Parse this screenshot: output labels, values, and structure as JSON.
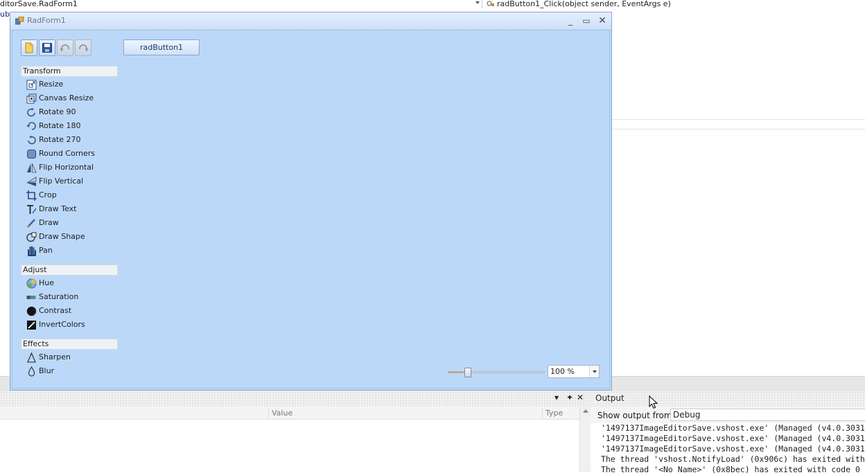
{
  "ide": {
    "nav_left": "ditorSave.RadForm1",
    "nav_right": "radButton1_Click(object sender, EventArgs e)",
    "code_snippet": "ub",
    "bottom_controls": {
      "dropdown": "▾",
      "pin": "✦",
      "close": "✕"
    },
    "output_title": "Output",
    "props": {
      "col_value": "Value",
      "col_type": "Type"
    },
    "output": {
      "show_from_label": "Show output from:",
      "source": "Debug",
      "lines": [
        "'1497137ImageEditorSave.vshost.exe' (Managed (v4.0.3031",
        "'1497137ImageEditorSave.vshost.exe' (Managed (v4.0.3031",
        "'1497137ImageEditorSave.vshost.exe' (Managed (v4.0.3031",
        "The thread 'vshost.NotifyLoad' (0x906c) has exited with",
        "The thread '<No Name>' (0x8bec) has exited with code 0"
      ]
    }
  },
  "form": {
    "title": "RadForm1",
    "minimize": "_",
    "maximize": "▭",
    "close": "✕",
    "button": "radButton1",
    "sections": [
      {
        "title": "Transform",
        "items": [
          {
            "label": "Resize",
            "icon": "resize-icon"
          },
          {
            "label": "Canvas Resize",
            "icon": "canvas-resize-icon"
          },
          {
            "label": "Rotate 90",
            "icon": "rotate-90-icon"
          },
          {
            "label": "Rotate 180",
            "icon": "rotate-180-icon"
          },
          {
            "label": "Rotate 270",
            "icon": "rotate-270-icon"
          },
          {
            "label": "Round Corners",
            "icon": "round-corners-icon"
          },
          {
            "label": "Flip Horizontal",
            "icon": "flip-horizontal-icon"
          },
          {
            "label": "Flip Vertical",
            "icon": "flip-vertical-icon"
          },
          {
            "label": "Crop",
            "icon": "crop-icon"
          },
          {
            "label": "Draw Text",
            "icon": "draw-text-icon"
          },
          {
            "label": "Draw",
            "icon": "draw-icon"
          },
          {
            "label": "Draw Shape",
            "icon": "draw-shape-icon"
          },
          {
            "label": "Pan",
            "icon": "pan-hand-icon"
          }
        ]
      },
      {
        "title": "Adjust",
        "items": [
          {
            "label": "Hue",
            "icon": "hue-icon"
          },
          {
            "label": "Saturation",
            "icon": "saturation-icon"
          },
          {
            "label": "Contrast",
            "icon": "contrast-icon"
          },
          {
            "label": "InvertColors",
            "icon": "invert-colors-icon"
          }
        ]
      },
      {
        "title": "Effects",
        "items": [
          {
            "label": "Sharpen",
            "icon": "sharpen-icon"
          },
          {
            "label": "Blur",
            "icon": "blur-icon"
          }
        ]
      }
    ],
    "zoom": {
      "value": "100 %",
      "slider_fraction": 0.2
    }
  },
  "colors": {
    "form_bg": "#bcd8f8",
    "accent_orange": "#e39b4e"
  }
}
